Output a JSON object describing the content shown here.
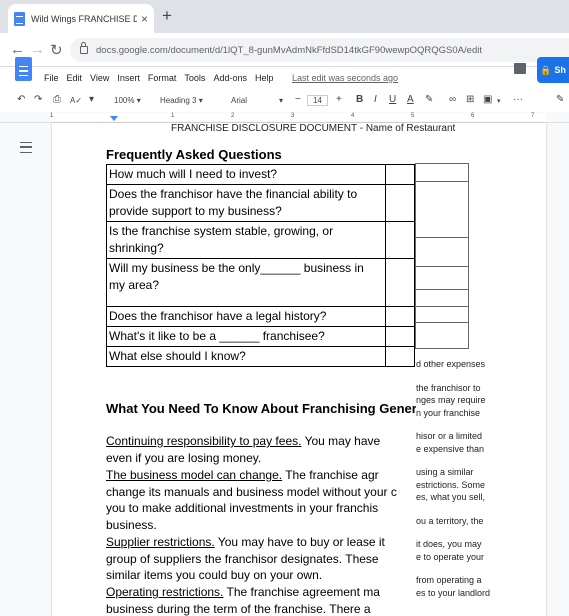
{
  "browser": {
    "tab_title": "Wild Wings FRANCHISE DISCLOS",
    "tab_close": "×",
    "new_tab": "+",
    "url": "docs.google.com/document/d/1lQT_8-gunMvAdmNkFfdSD14tkGF90wewpOQRQGS0A/edit"
  },
  "docs": {
    "menu": [
      "File",
      "Edit",
      "View",
      "Insert",
      "Format",
      "Tools",
      "Add-ons",
      "Help"
    ],
    "last_edit": "Last edit was seconds ago",
    "share_label": "Sh"
  },
  "toolbar": {
    "zoom": "100%",
    "style": "Heading 3",
    "font": "Arial",
    "font_size": "14",
    "minus": "−",
    "plus": "+",
    "bold": "B",
    "italic": "I",
    "underline": "U",
    "text_color": "A",
    "more": "···"
  },
  "ruler": {
    "numbers": [
      "1",
      "1",
      "2",
      "3",
      "4",
      "5",
      "6",
      "7"
    ]
  },
  "document": {
    "running_header": "FRANCHISE DISCLOSURE DOCUMENT - Name of Restaurant",
    "faq_heading": "Frequently Asked Questions",
    "faq": [
      "How much will I need to invest?",
      "Does the franchisor have the financial ability to provide support to my business?",
      "Is the franchise system stable, growing, or shrinking?",
      "Will my business be the only______ business in my area?",
      "Does the franchisor have a legal history?",
      "What's it like to be a ______ franchisee?",
      "What else should I know?"
    ],
    "overflow_texts": [
      "d other expenses",
      "the franchisor to",
      "nges may require",
      "n your franchise",
      "hisor or a limited",
      "e expensive than",
      "using a similar",
      "estrictions. Some",
      "es, what you sell,",
      "ou a territory, the",
      "it does, you may",
      "e to operate your",
      "from operating a",
      "es to your landlord"
    ],
    "section_heading": "What You Need To Know About Franchising Generally",
    "paragraphs": [
      {
        "label": "Continuing responsibility to pay fees.",
        "lines": [
          " You may have",
          "even if you are losing money."
        ]
      },
      {
        "label": "The business model can change.",
        "lines": [
          " The franchise agr",
          "change its manuals and business model without your c",
          "you to make additional investments in your franchis",
          "business."
        ]
      },
      {
        "label": "Supplier restrictions.",
        "lines": [
          " You may have to buy or lease it",
          "group of suppliers the franchisor designates. These",
          "similar items you could buy on your own."
        ]
      },
      {
        "label": "Operating restrictions.",
        "lines": [
          " The franchise agreement ma",
          "business during the term of the franchise. There a"
        ]
      }
    ]
  }
}
